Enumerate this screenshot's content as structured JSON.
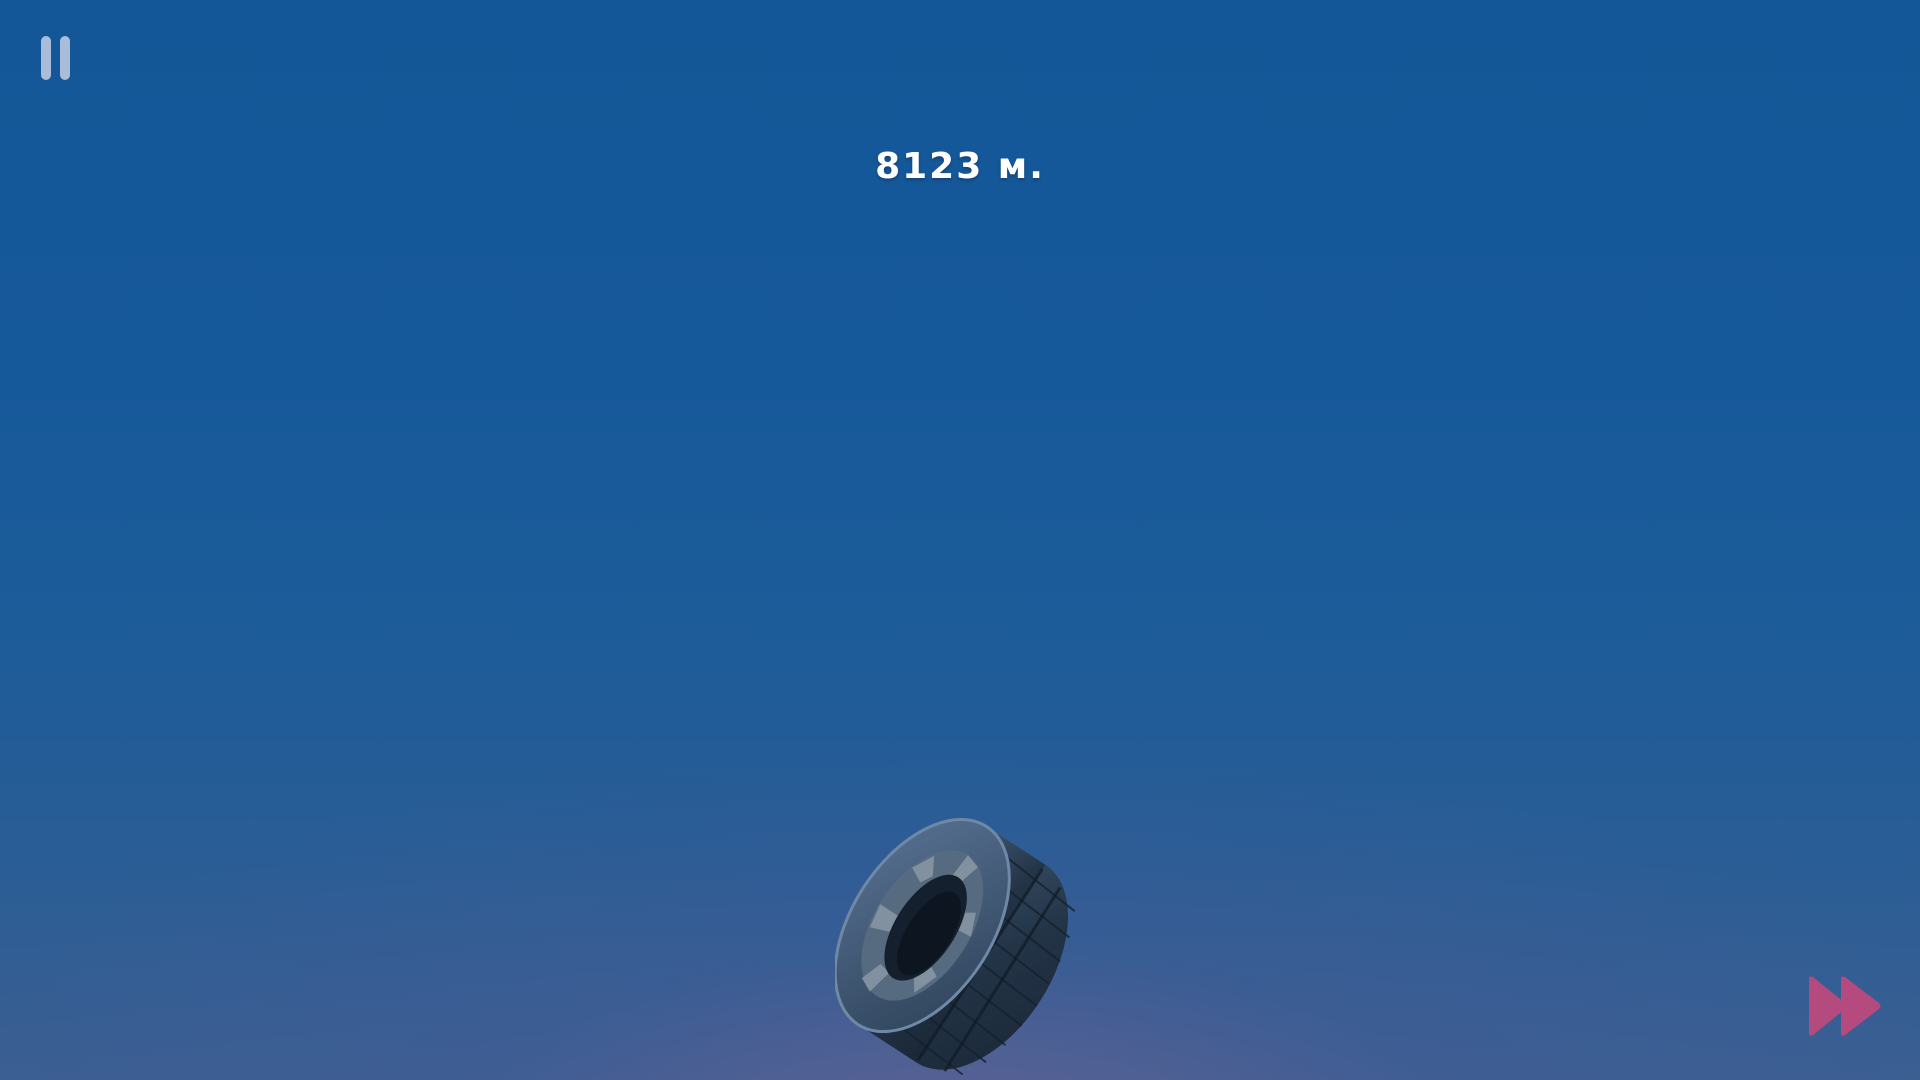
{
  "hud": {
    "distance_text": "8123 м."
  },
  "controls": {
    "pause_icon": "pause-icon",
    "fast_forward_icon": "fast-forward-icon"
  },
  "colors": {
    "sky_top": "#145798",
    "sky_bottom": "#3b5f92",
    "pause_icon": "#c4cee4",
    "fast_forward": "#b44a7e",
    "distance_text": "#ffffff"
  }
}
